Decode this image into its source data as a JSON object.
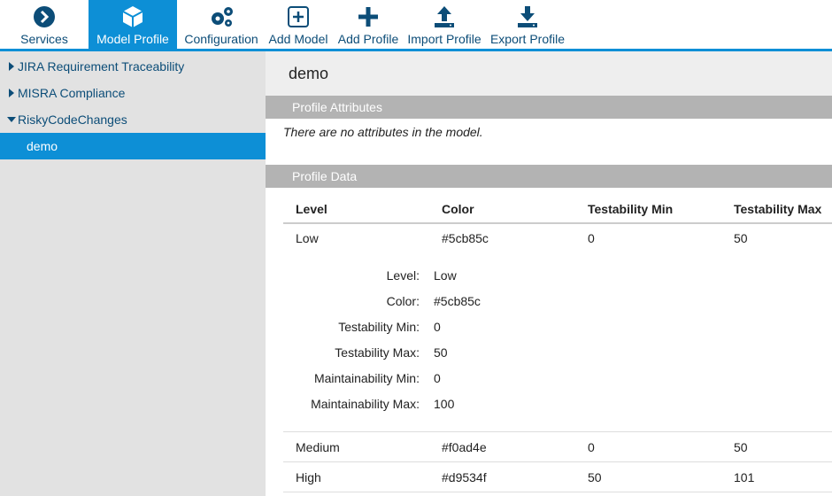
{
  "toolbar": {
    "services": "Services",
    "model_profile": "Model Profile",
    "configuration": "Configuration",
    "add_model": "Add Model",
    "add_profile": "Add Profile",
    "import_profile": "Import Profile",
    "export_profile": "Export Profile"
  },
  "sidebar": {
    "items": [
      {
        "label": "JIRA Requirement Traceability"
      },
      {
        "label": "MISRA Compliance"
      },
      {
        "label": "RiskyCodeChanges"
      },
      {
        "label": "demo"
      }
    ]
  },
  "main": {
    "title": "demo",
    "attributes_heading": "Profile Attributes",
    "no_attributes": "There are no attributes in the model.",
    "data_heading": "Profile Data",
    "columns": [
      "Level",
      "Color",
      "Testability Min",
      "Testability Max"
    ],
    "rows": [
      {
        "level": "Low",
        "color": "#5cb85c",
        "tmin": "0",
        "tmax": "50"
      },
      {
        "level": "Medium",
        "color": "#f0ad4e",
        "tmin": "0",
        "tmax": "50"
      },
      {
        "level": "High",
        "color": "#d9534f",
        "tmin": "50",
        "tmax": "101"
      }
    ],
    "detail": [
      {
        "key": "Level:",
        "value": "Low"
      },
      {
        "key": "Color:",
        "value": "#5cb85c"
      },
      {
        "key": "Testability Min:",
        "value": "0"
      },
      {
        "key": "Testability Max:",
        "value": "50"
      },
      {
        "key": "Maintainability Min:",
        "value": "0"
      },
      {
        "key": "Maintainability Max:",
        "value": "100"
      }
    ]
  },
  "colors": {
    "accent": "#0d8fd6",
    "nav_text": "#0c4d78",
    "section_bg": "#b3b3b3"
  },
  "icons": [
    "chevron-right-circle-icon",
    "cube-icon",
    "gears-icon",
    "add-box-icon",
    "plus-icon",
    "upload-icon",
    "download-icon",
    "caret-right-icon",
    "caret-down-icon"
  ]
}
